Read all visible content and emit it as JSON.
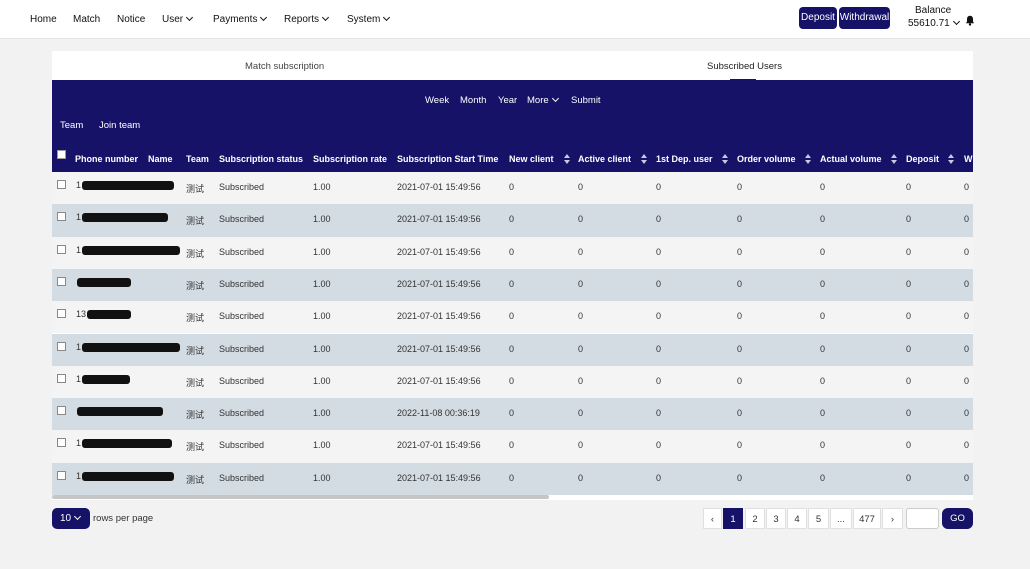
{
  "nav": {
    "home": "Home",
    "match": "Match",
    "notice": "Notice",
    "user": "User",
    "payments": "Payments",
    "reports": "Reports",
    "system": "System",
    "deposit": "Deposit",
    "withdrawal": "Withdrawal",
    "balance_label": "Balance",
    "balance_value": "55610.71"
  },
  "tabs": {
    "match_subscription": "Match subscription",
    "subscribed_users": "Subscribed Users"
  },
  "filters": {
    "week": "Week",
    "month": "Month",
    "year": "Year",
    "more": "More",
    "submit": "Submit",
    "team": "Team",
    "join_team": "Join team"
  },
  "table": {
    "headers": {
      "phone": "Phone number",
      "name": "Name",
      "team": "Team",
      "status": "Subscription status",
      "rate": "Subscription rate",
      "start_time": "Subscription Start Time",
      "new_client": "New client",
      "active_client": "Active client",
      "first_dep": "1st Dep. user",
      "order_volume": "Order volume",
      "actual_volume": "Actual volume",
      "deposit": "Deposit",
      "w": "W"
    },
    "rows": [
      {
        "phone": "1",
        "team": "测试",
        "status": "Subscribed",
        "rate": "1.00",
        "start": "2021-07-01 15:49:56",
        "new_client": "0",
        "active_client": "0",
        "first_dep": "0",
        "order_volume": "0",
        "actual_volume": "0",
        "deposit": "0",
        "w": "0"
      },
      {
        "phone": "1",
        "team": "测试",
        "status": "Subscribed",
        "rate": "1.00",
        "start": "2021-07-01 15:49:56",
        "new_client": "0",
        "active_client": "0",
        "first_dep": "0",
        "order_volume": "0",
        "actual_volume": "0",
        "deposit": "0",
        "w": "0"
      },
      {
        "phone": "1",
        "team": "测试",
        "status": "Subscribed",
        "rate": "1.00",
        "start": "2021-07-01 15:49:56",
        "new_client": "0",
        "active_client": "0",
        "first_dep": "0",
        "order_volume": "0",
        "actual_volume": "0",
        "deposit": "0",
        "w": "0"
      },
      {
        "phone": "",
        "team": "测试",
        "status": "Subscribed",
        "rate": "1.00",
        "start": "2021-07-01 15:49:56",
        "new_client": "0",
        "active_client": "0",
        "first_dep": "0",
        "order_volume": "0",
        "actual_volume": "0",
        "deposit": "0",
        "w": "0"
      },
      {
        "phone": "13",
        "team": "测试",
        "status": "Subscribed",
        "rate": "1.00",
        "start": "2021-07-01 15:49:56",
        "new_client": "0",
        "active_client": "0",
        "first_dep": "0",
        "order_volume": "0",
        "actual_volume": "0",
        "deposit": "0",
        "w": "0"
      },
      {
        "phone": "1",
        "team": "测试",
        "status": "Subscribed",
        "rate": "1.00",
        "start": "2021-07-01 15:49:56",
        "new_client": "0",
        "active_client": "0",
        "first_dep": "0",
        "order_volume": "0",
        "actual_volume": "0",
        "deposit": "0",
        "w": "0"
      },
      {
        "phone": "1",
        "team": "测试",
        "status": "Subscribed",
        "rate": "1.00",
        "start": "2021-07-01 15:49:56",
        "new_client": "0",
        "active_client": "0",
        "first_dep": "0",
        "order_volume": "0",
        "actual_volume": "0",
        "deposit": "0",
        "w": "0"
      },
      {
        "phone": "",
        "team": "测试",
        "status": "Subscribed",
        "rate": "1.00",
        "start": "2022-11-08 00:36:19",
        "new_client": "0",
        "active_client": "0",
        "first_dep": "0",
        "order_volume": "0",
        "actual_volume": "0",
        "deposit": "0",
        "w": "0"
      },
      {
        "phone": "1",
        "team": "测试",
        "status": "Subscribed",
        "rate": "1.00",
        "start": "2021-07-01 15:49:56",
        "new_client": "0",
        "active_client": "0",
        "first_dep": "0",
        "order_volume": "0",
        "actual_volume": "0",
        "deposit": "0",
        "w": "0"
      },
      {
        "phone": "1",
        "team": "测试",
        "status": "Subscribed",
        "rate": "1.00",
        "start": "2021-07-01 15:49:56",
        "new_client": "0",
        "active_client": "0",
        "first_dep": "0",
        "order_volume": "0",
        "actual_volume": "0",
        "deposit": "0",
        "w": "0"
      }
    ]
  },
  "pagination": {
    "rows_per_page_value": "10",
    "rows_per_page_label": "rows per page",
    "prev": "‹",
    "pages": [
      "1",
      "2",
      "3",
      "4",
      "5",
      "...",
      "477"
    ],
    "next": "›",
    "go_value": "",
    "go": "GO"
  },
  "colors": {
    "primary": "#151268",
    "row_alt": "#d3dbe3"
  }
}
